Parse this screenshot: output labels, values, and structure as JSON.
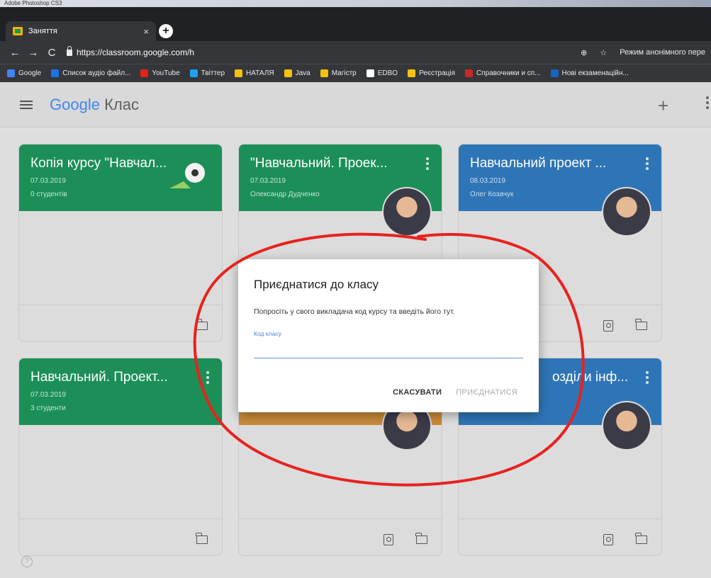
{
  "os": {
    "title": "Adobe Photoshop CS3"
  },
  "browser": {
    "tab": {
      "title": "Заняття",
      "close": "×"
    },
    "newtab": "+",
    "url": "https://classroom.google.com/h",
    "incognito": "Режим анонімного пере",
    "bookmarks": [
      {
        "label": "Google",
        "color": "#4285f4"
      },
      {
        "label": "Список аудіо файл...",
        "color": "#1a73e8"
      },
      {
        "label": "YouTube",
        "color": "#e62117"
      },
      {
        "label": "Твіттер",
        "color": "#1da1f2"
      },
      {
        "label": "НАТАЛЯ",
        "color": "#f4c20d"
      },
      {
        "label": "Java",
        "color": "#f4c20d"
      },
      {
        "label": "Магістр",
        "color": "#f4c20d"
      },
      {
        "label": "EDBO",
        "color": "#ffffff"
      },
      {
        "label": "Реєстрація",
        "color": "#f4c20d"
      },
      {
        "label": "Справочники и сп...",
        "color": "#c62828"
      },
      {
        "label": "Нові екзаменаційн...",
        "color": "#1565c0"
      }
    ]
  },
  "app": {
    "brand_google": "Google",
    "brand_product": "Клас",
    "add": "+"
  },
  "cards": [
    {
      "title": "Копія курсу \"Навчал...",
      "date": "07.03.2019",
      "sub": "0 студентів",
      "theme": "green"
    },
    {
      "title": "\"Навчальний. Проек...",
      "date": "07.03.2019",
      "sub": "Олександр Дудченко",
      "theme": "green"
    },
    {
      "title": "Навчальний проект ...",
      "date": "08.03.2019",
      "sub": "Олег Козачук",
      "theme": "blue"
    },
    {
      "title": "Навчальний. Проект...",
      "date": "07.03.2019",
      "sub": "3 студенти",
      "theme": "green"
    },
    {
      "title": "",
      "date": "",
      "sub": "",
      "theme": "orange"
    },
    {
      "title": "озділи інф...",
      "date": "",
      "sub": "",
      "theme": "blue"
    }
  ],
  "dialog": {
    "title": "Приєднатися до класу",
    "description": "Попросіть у свого викладача код курсу та введіть його тут.",
    "field_label": "Код класу",
    "field_value": "",
    "cancel": "СКАСУВАТИ",
    "join": "ПРИЄДНАТИСЯ"
  },
  "help": "?"
}
